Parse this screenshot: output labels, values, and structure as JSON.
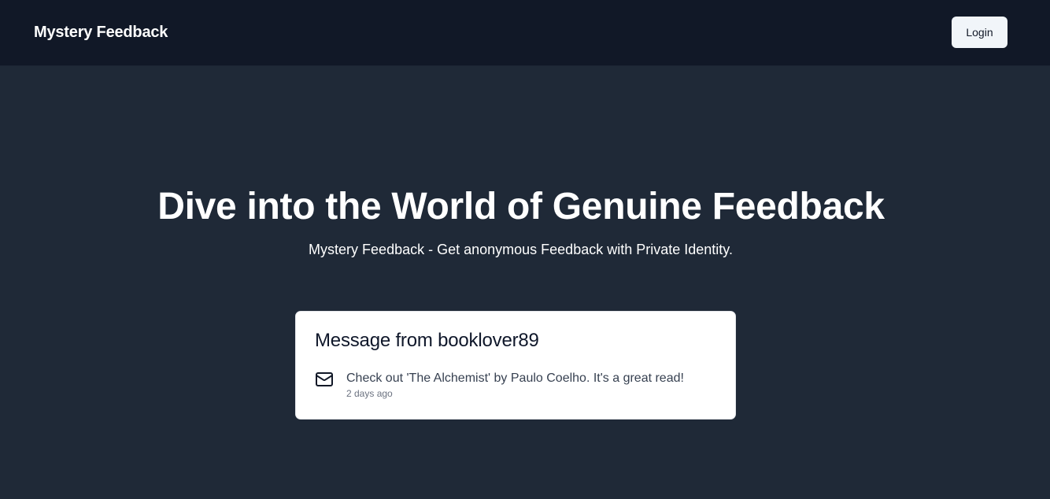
{
  "navbar": {
    "brand": "Mystery Feedback",
    "login_label": "Login"
  },
  "hero": {
    "title": "Dive into the World of Genuine Feedback",
    "subtitle": "Mystery Feedback - Get anonymous Feedback with Private Identity."
  },
  "message_card": {
    "title": "Message from booklover89",
    "icon": "mail-icon",
    "content": "Check out 'The Alchemist' by Paulo Coelho. It's a great read!",
    "timestamp": "2 days ago"
  },
  "colors": {
    "navbar_bg": "#111827",
    "page_bg": "#1f2937",
    "card_bg": "#ffffff",
    "button_bg": "#f1f5f9"
  }
}
